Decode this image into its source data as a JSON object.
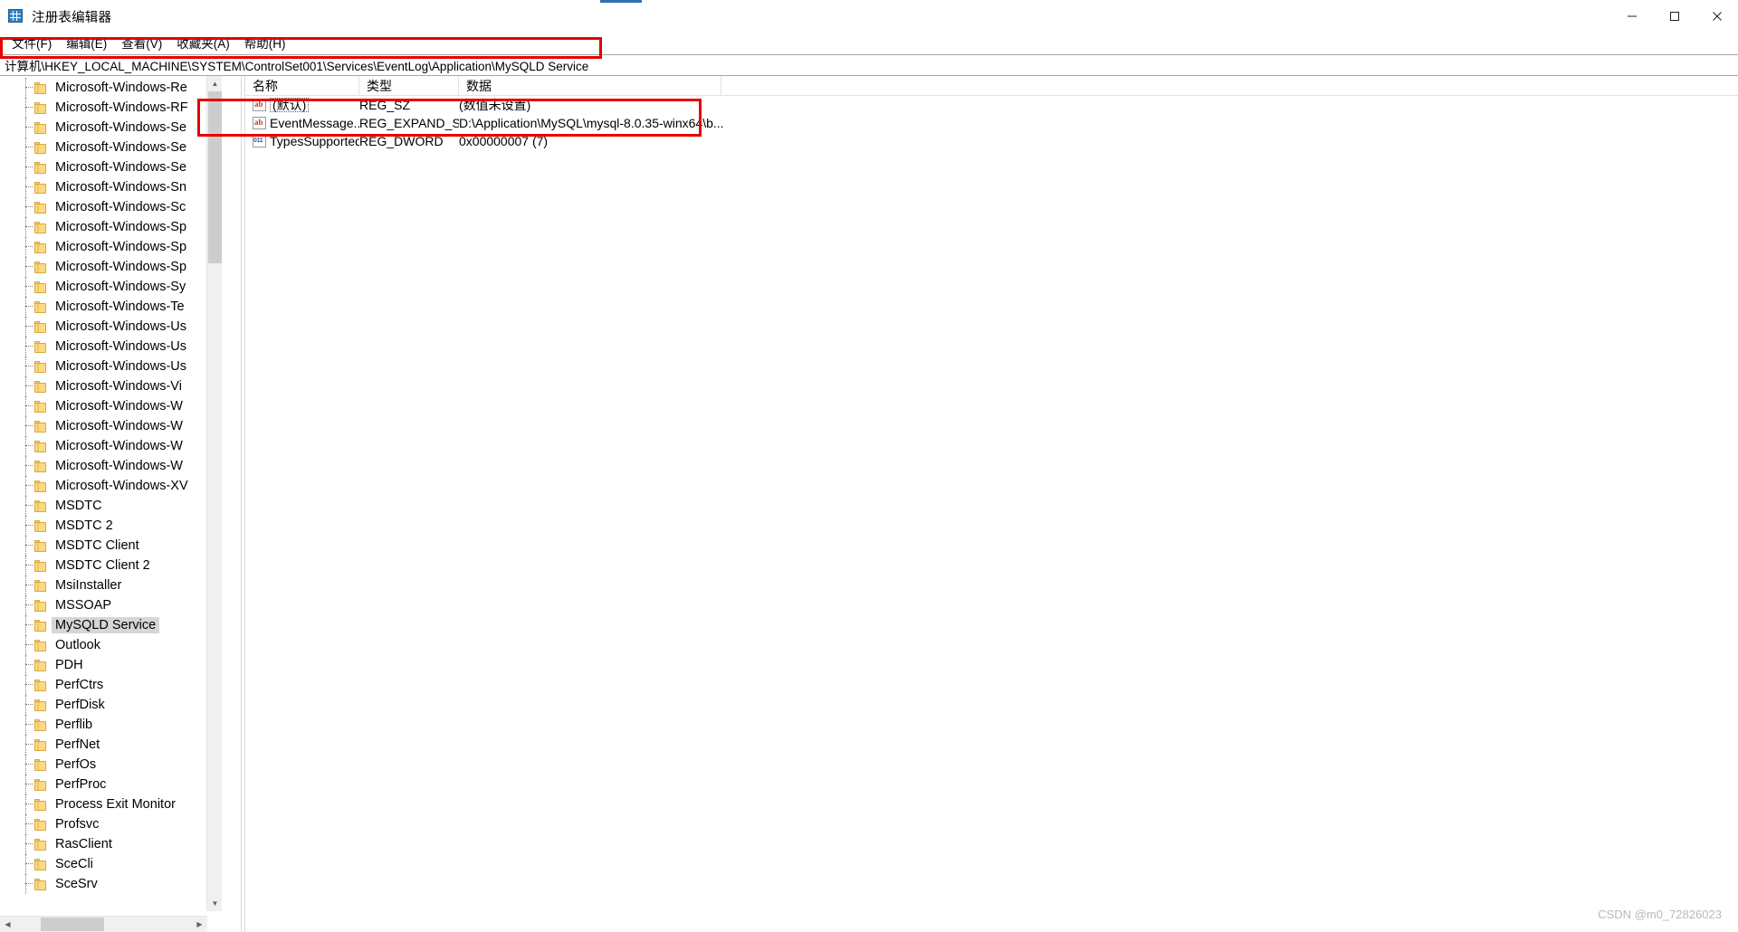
{
  "window": {
    "title": "注册表编辑器",
    "icon": "registry-editor-icon",
    "minimize_label": "−",
    "maximize_label": "▢",
    "close_label": "✕"
  },
  "menubar": {
    "items": [
      {
        "label": "文件(F)",
        "name": "menu-file"
      },
      {
        "label": "编辑(E)",
        "name": "menu-edit"
      },
      {
        "label": "查看(V)",
        "name": "menu-view"
      },
      {
        "label": "收藏夹(A)",
        "name": "menu-favorites"
      },
      {
        "label": "帮助(H)",
        "name": "menu-help"
      }
    ]
  },
  "address": {
    "value": "计算机\\HKEY_LOCAL_MACHINE\\SYSTEM\\ControlSet001\\Services\\EventLog\\Application\\MySQLD Service",
    "placeholder": "计算机\\"
  },
  "tree": {
    "selected": "MySQLD Service",
    "items": [
      "Microsoft-Windows-Re",
      "Microsoft-Windows-RF",
      "Microsoft-Windows-Se",
      "Microsoft-Windows-Se",
      "Microsoft-Windows-Se",
      "Microsoft-Windows-Sn",
      "Microsoft-Windows-Sc",
      "Microsoft-Windows-Sp",
      "Microsoft-Windows-Sp",
      "Microsoft-Windows-Sp",
      "Microsoft-Windows-Sy",
      "Microsoft-Windows-Te",
      "Microsoft-Windows-Us",
      "Microsoft-Windows-Us",
      "Microsoft-Windows-Us",
      "Microsoft-Windows-Vi",
      "Microsoft-Windows-W",
      "Microsoft-Windows-W",
      "Microsoft-Windows-W",
      "Microsoft-Windows-W",
      "Microsoft-Windows-XV",
      "MSDTC",
      "MSDTC 2",
      "MSDTC Client",
      "MSDTC Client 2",
      "MsiInstaller",
      "MSSOAP",
      "MySQLD Service",
      "Outlook",
      "PDH",
      "PerfCtrs",
      "PerfDisk",
      "Perflib",
      "PerfNet",
      "PerfOs",
      "PerfProc",
      "Process Exit Monitor",
      "Profsvc",
      "RasClient",
      "SceCli",
      "SceSrv"
    ]
  },
  "values": {
    "columns": [
      {
        "label": "名称",
        "name": "column-name"
      },
      {
        "label": "类型",
        "name": "column-type"
      },
      {
        "label": "数据",
        "name": "column-data"
      }
    ],
    "rows": [
      {
        "icon": "string-value-icon",
        "name": "(默认)",
        "type": "REG_SZ",
        "data": "(数值未设置)",
        "highlighted": false
      },
      {
        "icon": "string-value-icon",
        "name": "EventMessage...",
        "type": "REG_EXPAND_SZ",
        "data": "D:\\Application\\MySQL\\mysql-8.0.35-winx64\\b...",
        "highlighted": true
      },
      {
        "icon": "dword-value-icon",
        "name": "TypesSupported",
        "type": "REG_DWORD",
        "data": "0x00000007 (7)",
        "highlighted": true
      }
    ]
  },
  "scrollbars": {
    "tree_vertical_up": "▲",
    "tree_vertical_down": "▼",
    "tree_horizontal_left": "◀",
    "tree_horizontal_right": "▶"
  },
  "annotations": {
    "color": "#e60000",
    "address_box_name": "annotation-address-path",
    "values_box_name": "annotation-registry-values"
  },
  "watermark": {
    "text": "CSDN @m0_72826023"
  }
}
